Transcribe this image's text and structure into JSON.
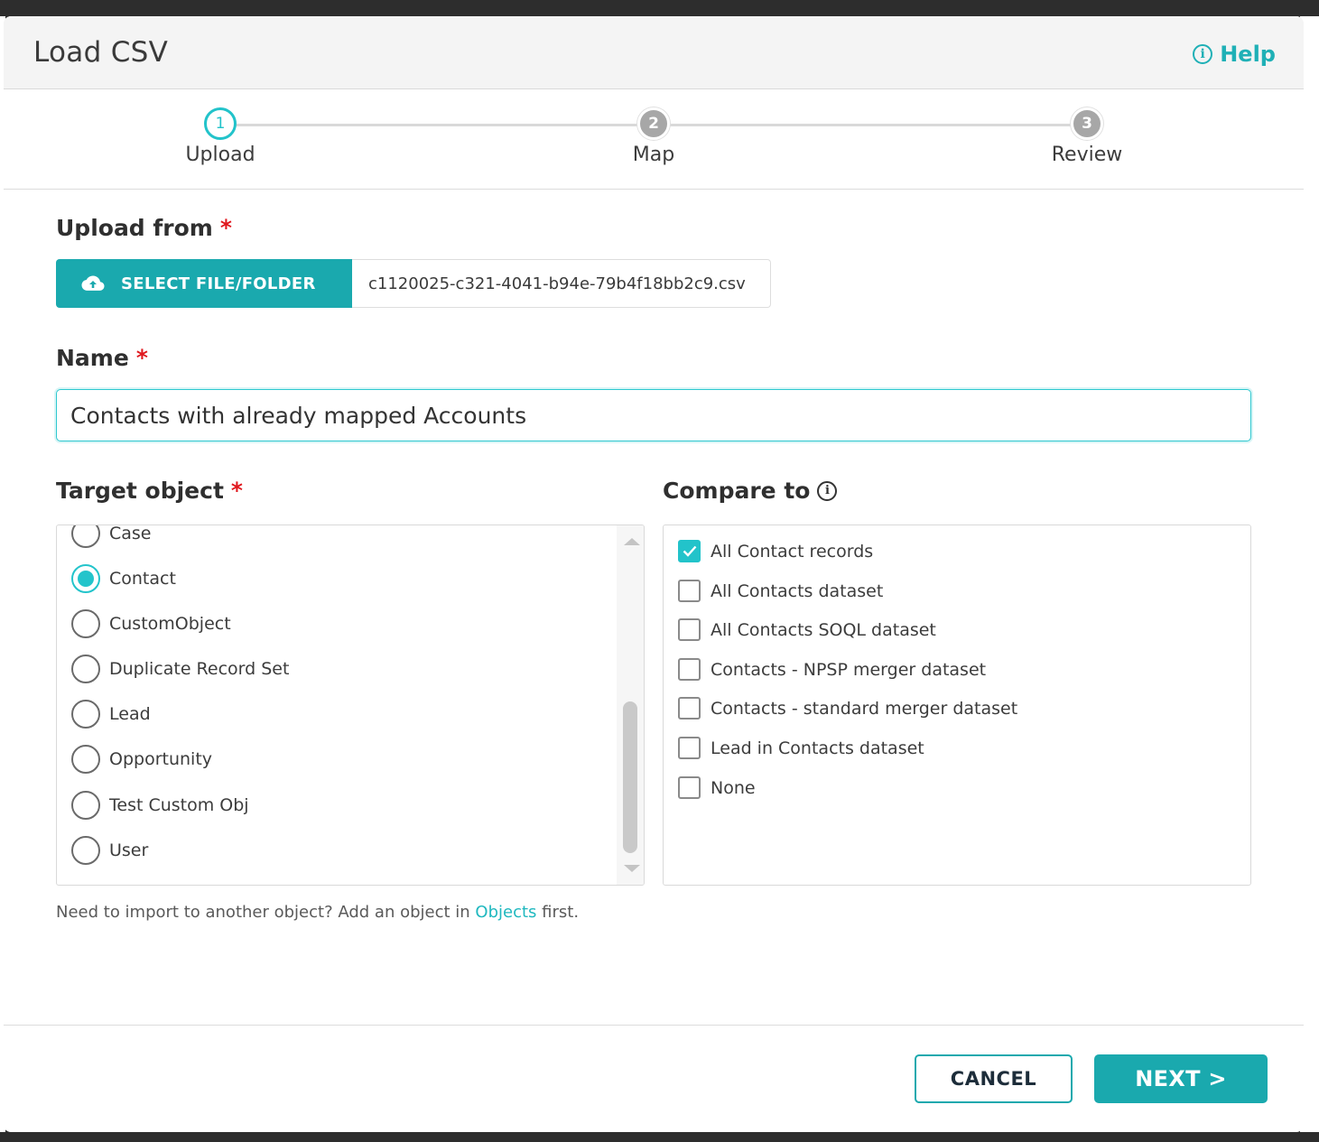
{
  "dialog": {
    "title": "Load CSV",
    "help_label": "Help",
    "help_icon": "info-icon"
  },
  "stepper": {
    "steps": [
      {
        "number": "1",
        "label": "Upload",
        "state": "active"
      },
      {
        "number": "2",
        "label": "Map",
        "state": "inactive"
      },
      {
        "number": "3",
        "label": "Review",
        "state": "inactive"
      }
    ]
  },
  "upload": {
    "label": "Upload from",
    "required_mark": "*",
    "select_button_label": "SELECT FILE/FOLDER",
    "select_button_icon": "cloud-upload-icon",
    "file_name": "c1120025-c321-4041-b94e-79b4f18bb2c9.csv"
  },
  "name_field": {
    "label": "Name",
    "required_mark": "*",
    "value": "Contacts with already mapped Accounts"
  },
  "target_object": {
    "label": "Target object",
    "required_mark": "*",
    "options": [
      "Case",
      "Contact",
      "CustomObject",
      "Duplicate Record Set",
      "Lead",
      "Opportunity",
      "Test Custom Obj",
      "User"
    ],
    "selected": "Contact"
  },
  "compare_to": {
    "label": "Compare to",
    "info_icon": "info-icon",
    "options": [
      {
        "label": "All Contact records",
        "checked": true
      },
      {
        "label": "All Contacts dataset",
        "checked": false
      },
      {
        "label": "All Contacts SOQL dataset",
        "checked": false
      },
      {
        "label": "Contacts - NPSP merger dataset",
        "checked": false
      },
      {
        "label": "Contacts - standard merger dataset",
        "checked": false
      },
      {
        "label": "Lead in Contacts dataset",
        "checked": false
      },
      {
        "label": "None",
        "checked": false
      }
    ]
  },
  "hint": {
    "prefix": "Need to import to another object? Add an object in ",
    "link": "Objects",
    "suffix": " first."
  },
  "footer": {
    "cancel_label": "CANCEL",
    "next_label": "NEXT >"
  },
  "colors": {
    "accent": "#1aa9ae",
    "accent_light": "#22c3ca",
    "required": "#e0181e"
  }
}
